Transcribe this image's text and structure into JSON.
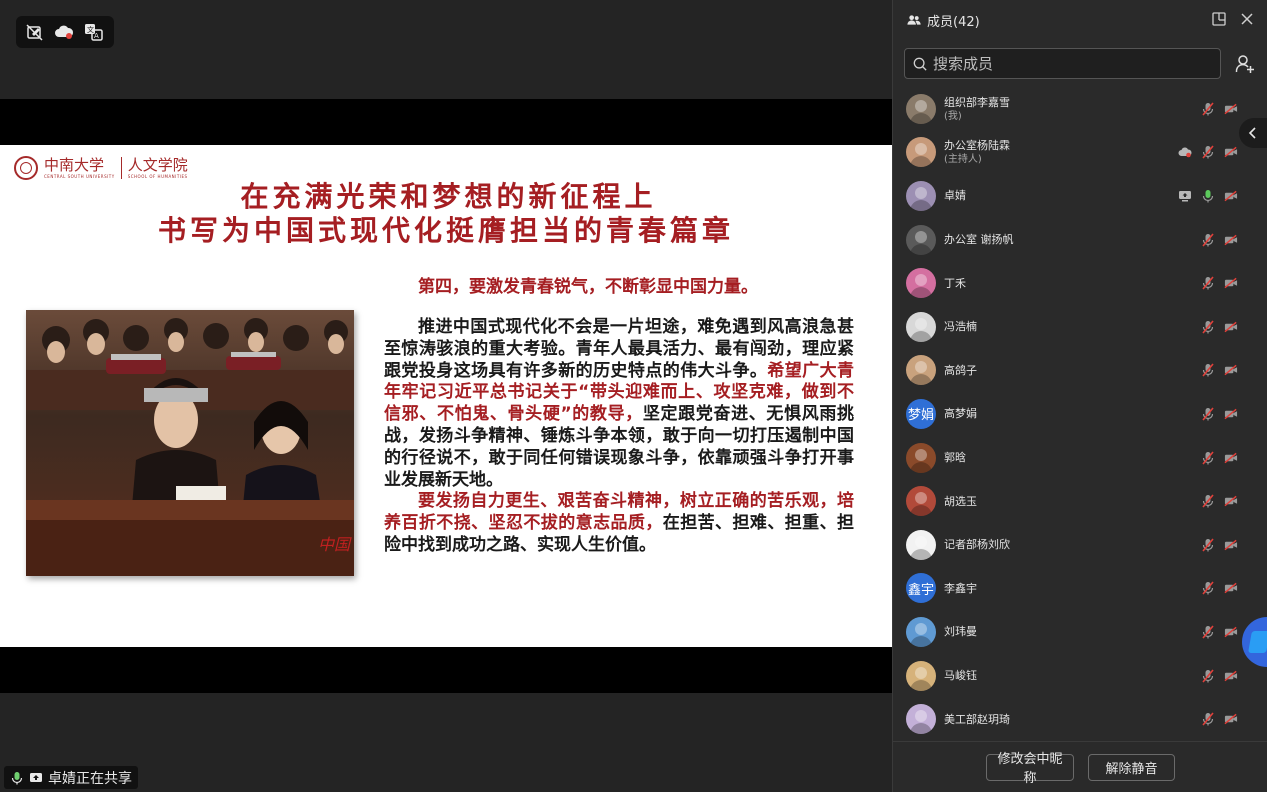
{
  "stage": {
    "slide": {
      "logo_cn": "中南大学",
      "logo_en": "CENTRAL SOUTH UNIVERSITY",
      "logo_dept_cn": "人文学院",
      "logo_dept_en": "SCHOOL OF HUMANITIES",
      "title_line1": "在充满光荣和梦想的新征程上",
      "title_line2": "书写为中国式现代化挺膺担当的青春篇章",
      "subtitle": "第四，要激发青春锐气，不断彰显中国力量。",
      "para1_a": "推进中国式现代化不会是一片坦途，难免遇到风高浪急甚至惊涛骇浪的重大考验。青年人最具活力、最有闯劲，理应紧跟党投身这场具有许多新的历史特点的伟大斗争。",
      "para1_b": "希望广大青年牢记习近平总书记关于“带头迎难而上、攻坚克难，做到不信邪、不怕鬼、骨头硬”的教导，",
      "para1_c": "坚定跟党奋进、无惧风雨挑战，发扬斗争精神、锤炼斗争本领，敢于向一切打压遏制中国的行径说不，敢于同任何错误现象斗争，依靠顽强斗争打开事业发展新天地。",
      "para2_a": "要发扬自力更生、艰苦奋斗精神，树立正确的苦乐观，培养百折不挠、坚忍不拔的意志品质，",
      "para2_b": "在担苦、担难、担重、担险中找到成功之路、实现人生价值。"
    },
    "share_status": "卓婧正在共享"
  },
  "panel": {
    "title": "成员(42)",
    "search_placeholder": "搜索成员",
    "members": [
      {
        "name": "组织部李嘉雪",
        "role": "(我)",
        "avatar_text": "",
        "avatar_color": "#8a7b6a"
      },
      {
        "name": "办公室杨陆霖",
        "role": "(主持人)",
        "avatar_text": "",
        "avatar_color": "#c79a7a"
      },
      {
        "name": "卓婧",
        "role": "",
        "avatar_text": "",
        "avatar_color": "#9c8fb3"
      },
      {
        "name": "办公室 谢扬帆",
        "role": "",
        "avatar_text": "",
        "avatar_color": "#5a5a5a"
      },
      {
        "name": "丁禾",
        "role": "",
        "avatar_text": "",
        "avatar_color": "#d46fa0"
      },
      {
        "name": "冯浩楠",
        "role": "",
        "avatar_text": "",
        "avatar_color": "#d8d8d8"
      },
      {
        "name": "高鸽子",
        "role": "",
        "avatar_text": "",
        "avatar_color": "#c9a27d"
      },
      {
        "name": "高梦娟",
        "role": "",
        "avatar_text": "梦娟",
        "avatar_color": "#2f6fd6"
      },
      {
        "name": "郭晗",
        "role": "",
        "avatar_text": "",
        "avatar_color": "#8a4a2a"
      },
      {
        "name": "胡选玉",
        "role": "",
        "avatar_text": "",
        "avatar_color": "#b24a3a"
      },
      {
        "name": "记者部杨刘欣",
        "role": "",
        "avatar_text": "",
        "avatar_color": "#f2f2f2"
      },
      {
        "name": "李鑫宇",
        "role": "",
        "avatar_text": "鑫宇",
        "avatar_color": "#2f6fd6"
      },
      {
        "name": "刘玮曼",
        "role": "",
        "avatar_text": "",
        "avatar_color": "#5f9ad3"
      },
      {
        "name": "马峻钰",
        "role": "",
        "avatar_text": "",
        "avatar_color": "#d6b27a"
      },
      {
        "name": "美工部赵玥琦",
        "role": "",
        "avatar_text": "",
        "avatar_color": "#c3b0d8"
      }
    ],
    "footer": {
      "rename_label": "修改会中昵称",
      "unmute_label": "解除静音"
    }
  },
  "colors": {
    "accent_red": "#a51e22",
    "muted_red": "#e0403a",
    "panel_bg": "#2a2a2a"
  }
}
